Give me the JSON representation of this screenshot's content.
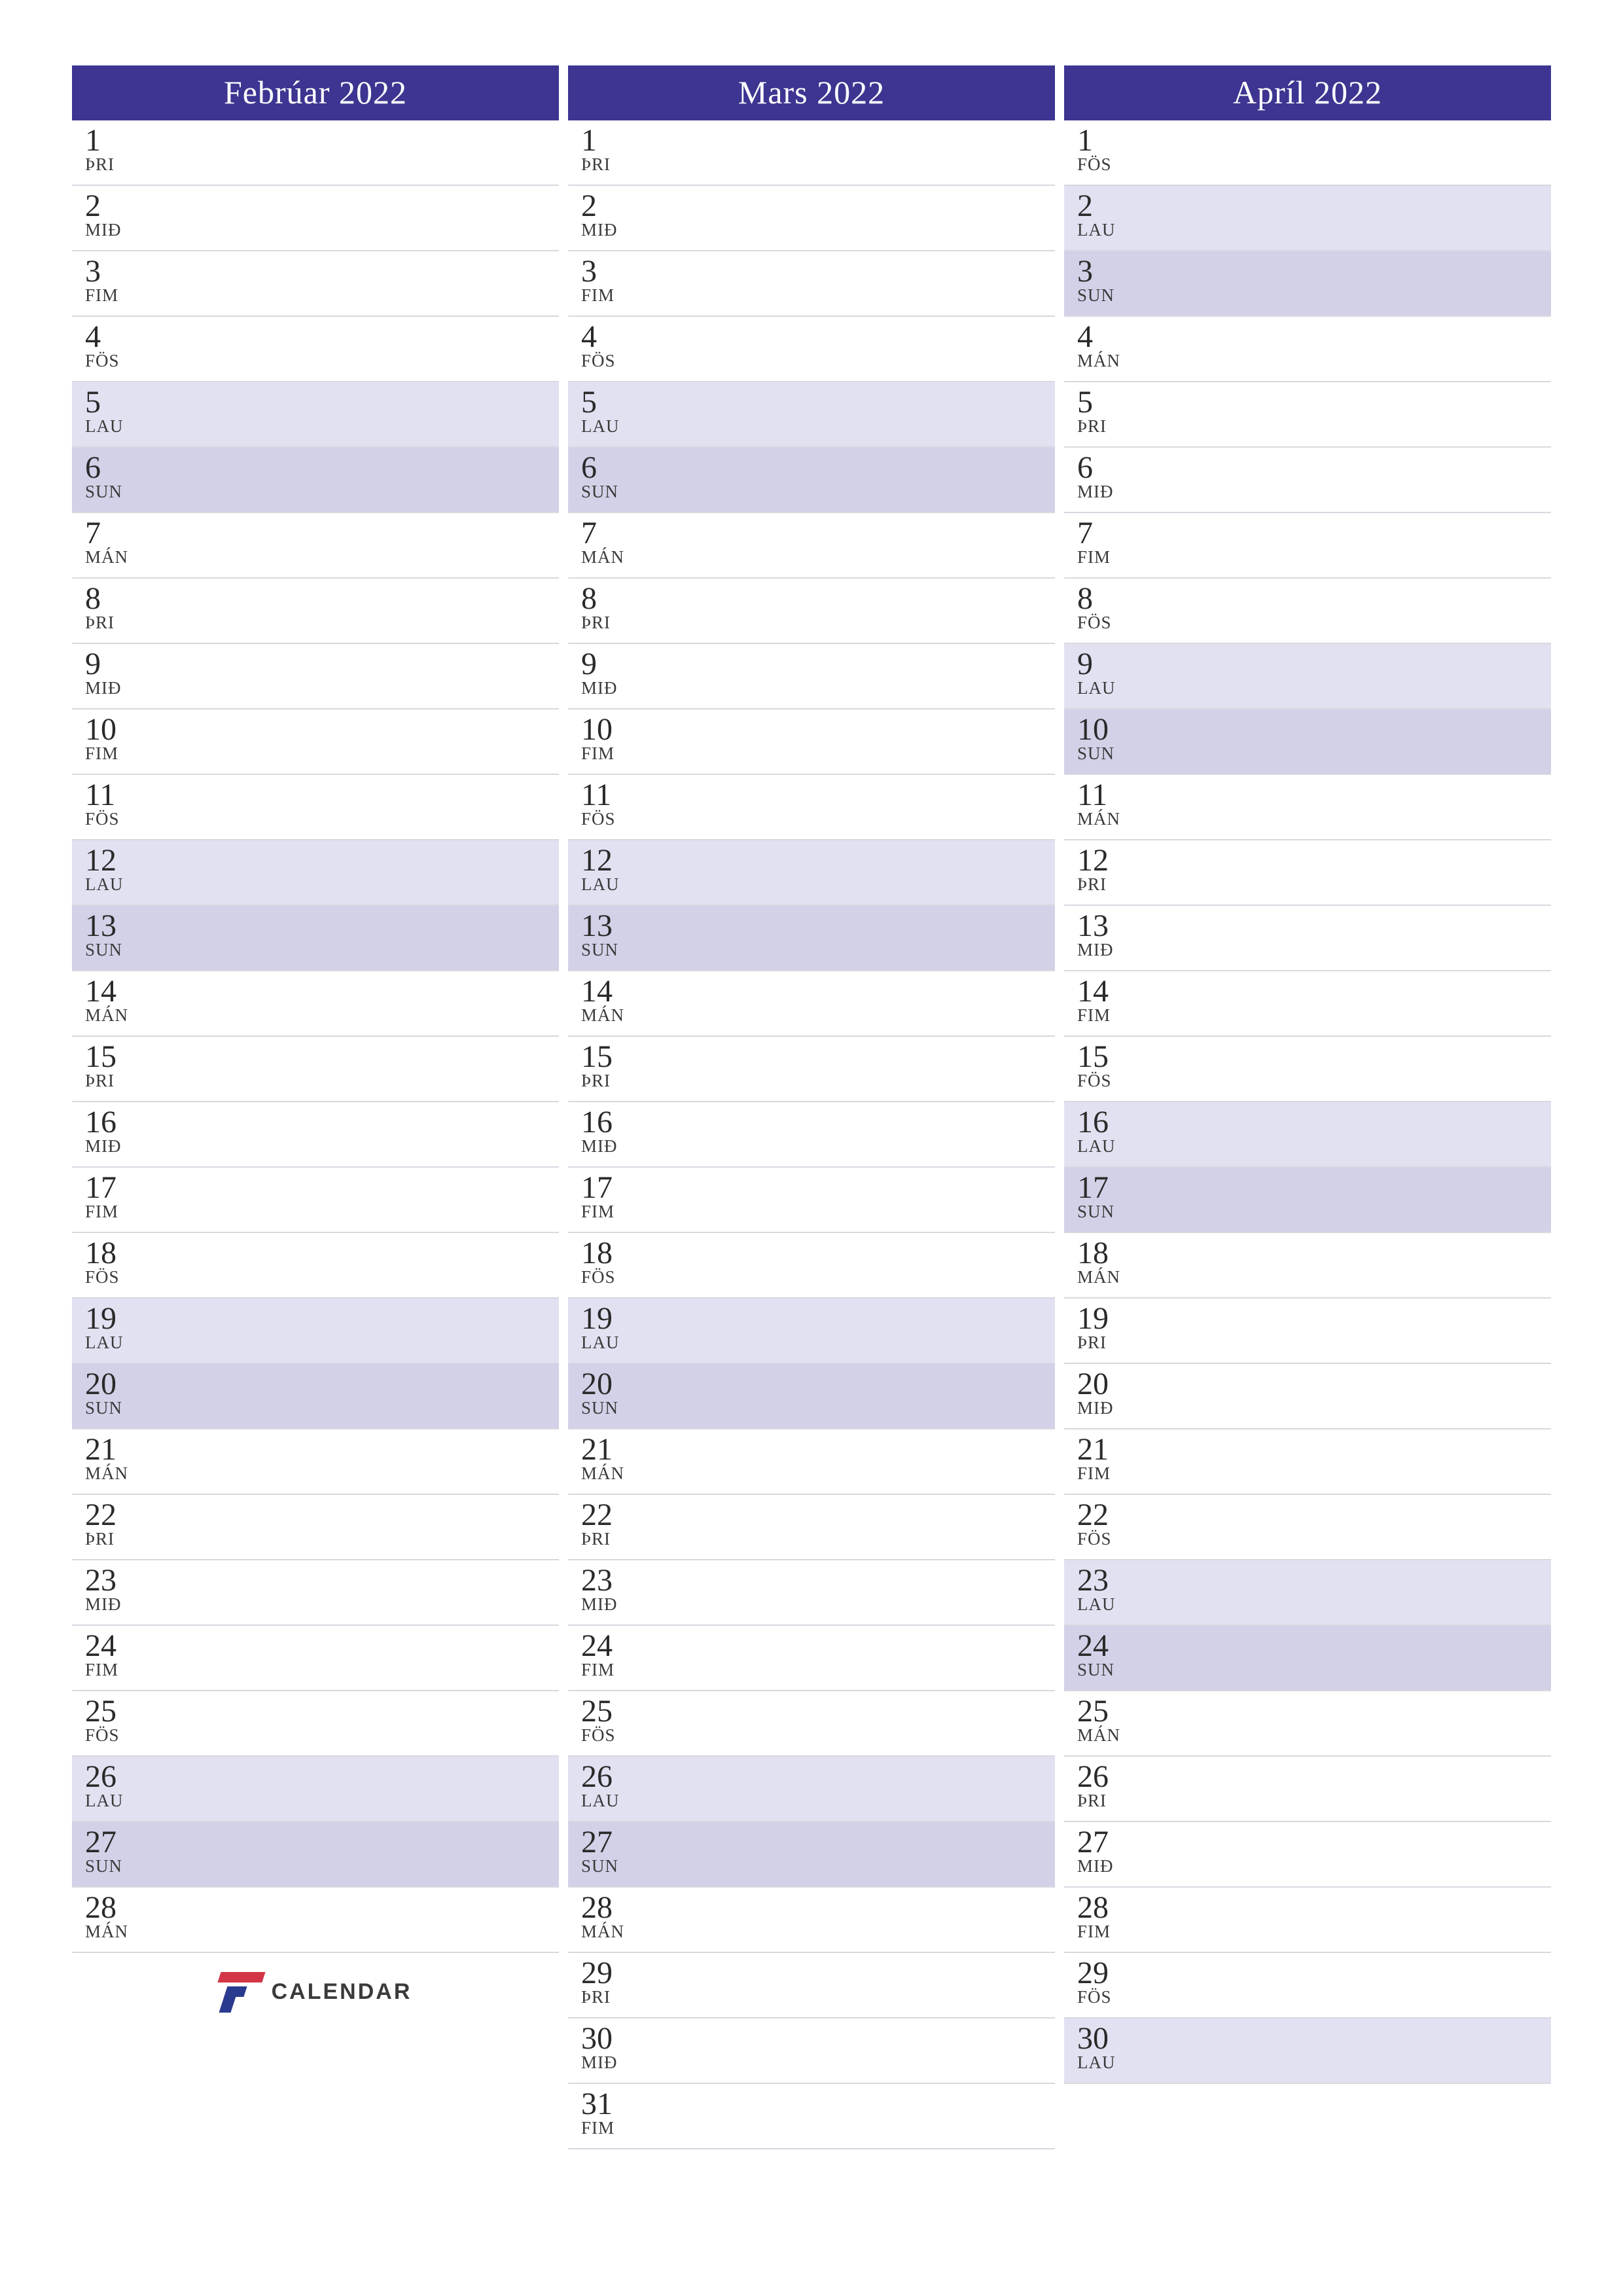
{
  "brand": {
    "name": "CALENDAR"
  },
  "weekday_labels": {
    "mon": "MÁN",
    "tue": "ÞRI",
    "wed": "MIÐ",
    "thu": "FIM",
    "fri": "FÖS",
    "sat": "LAU",
    "sun": "SUN"
  },
  "months": [
    {
      "title": "Febrúar 2022",
      "logo_after": 28,
      "days": [
        {
          "n": "1",
          "w": "tue"
        },
        {
          "n": "2",
          "w": "wed"
        },
        {
          "n": "3",
          "w": "thu"
        },
        {
          "n": "4",
          "w": "fri"
        },
        {
          "n": "5",
          "w": "sat"
        },
        {
          "n": "6",
          "w": "sun"
        },
        {
          "n": "7",
          "w": "mon"
        },
        {
          "n": "8",
          "w": "tue"
        },
        {
          "n": "9",
          "w": "wed"
        },
        {
          "n": "10",
          "w": "thu"
        },
        {
          "n": "11",
          "w": "fri"
        },
        {
          "n": "12",
          "w": "sat"
        },
        {
          "n": "13",
          "w": "sun"
        },
        {
          "n": "14",
          "w": "mon"
        },
        {
          "n": "15",
          "w": "tue"
        },
        {
          "n": "16",
          "w": "wed"
        },
        {
          "n": "17",
          "w": "thu"
        },
        {
          "n": "18",
          "w": "fri"
        },
        {
          "n": "19",
          "w": "sat"
        },
        {
          "n": "20",
          "w": "sun"
        },
        {
          "n": "21",
          "w": "mon"
        },
        {
          "n": "22",
          "w": "tue"
        },
        {
          "n": "23",
          "w": "wed"
        },
        {
          "n": "24",
          "w": "thu"
        },
        {
          "n": "25",
          "w": "fri"
        },
        {
          "n": "26",
          "w": "sat"
        },
        {
          "n": "27",
          "w": "sun"
        },
        {
          "n": "28",
          "w": "mon"
        }
      ]
    },
    {
      "title": "Mars 2022",
      "days": [
        {
          "n": "1",
          "w": "tue"
        },
        {
          "n": "2",
          "w": "wed"
        },
        {
          "n": "3",
          "w": "thu"
        },
        {
          "n": "4",
          "w": "fri"
        },
        {
          "n": "5",
          "w": "sat"
        },
        {
          "n": "6",
          "w": "sun"
        },
        {
          "n": "7",
          "w": "mon"
        },
        {
          "n": "8",
          "w": "tue"
        },
        {
          "n": "9",
          "w": "wed"
        },
        {
          "n": "10",
          "w": "thu"
        },
        {
          "n": "11",
          "w": "fri"
        },
        {
          "n": "12",
          "w": "sat"
        },
        {
          "n": "13",
          "w": "sun"
        },
        {
          "n": "14",
          "w": "mon"
        },
        {
          "n": "15",
          "w": "tue"
        },
        {
          "n": "16",
          "w": "wed"
        },
        {
          "n": "17",
          "w": "thu"
        },
        {
          "n": "18",
          "w": "fri"
        },
        {
          "n": "19",
          "w": "sat"
        },
        {
          "n": "20",
          "w": "sun"
        },
        {
          "n": "21",
          "w": "mon"
        },
        {
          "n": "22",
          "w": "tue"
        },
        {
          "n": "23",
          "w": "wed"
        },
        {
          "n": "24",
          "w": "thu"
        },
        {
          "n": "25",
          "w": "fri"
        },
        {
          "n": "26",
          "w": "sat"
        },
        {
          "n": "27",
          "w": "sun"
        },
        {
          "n": "28",
          "w": "mon"
        },
        {
          "n": "29",
          "w": "tue"
        },
        {
          "n": "30",
          "w": "wed"
        },
        {
          "n": "31",
          "w": "thu"
        }
      ]
    },
    {
      "title": "Apríl 2022",
      "days": [
        {
          "n": "1",
          "w": "fri"
        },
        {
          "n": "2",
          "w": "sat"
        },
        {
          "n": "3",
          "w": "sun"
        },
        {
          "n": "4",
          "w": "mon"
        },
        {
          "n": "5",
          "w": "tue"
        },
        {
          "n": "6",
          "w": "wed"
        },
        {
          "n": "7",
          "w": "thu"
        },
        {
          "n": "8",
          "w": "fri"
        },
        {
          "n": "9",
          "w": "sat"
        },
        {
          "n": "10",
          "w": "sun"
        },
        {
          "n": "11",
          "w": "mon"
        },
        {
          "n": "12",
          "w": "tue"
        },
        {
          "n": "13",
          "w": "wed"
        },
        {
          "n": "14",
          "w": "thu"
        },
        {
          "n": "15",
          "w": "fri"
        },
        {
          "n": "16",
          "w": "sat"
        },
        {
          "n": "17",
          "w": "sun"
        },
        {
          "n": "18",
          "w": "mon"
        },
        {
          "n": "19",
          "w": "tue"
        },
        {
          "n": "20",
          "w": "wed"
        },
        {
          "n": "21",
          "w": "thu"
        },
        {
          "n": "22",
          "w": "fri"
        },
        {
          "n": "23",
          "w": "sat"
        },
        {
          "n": "24",
          "w": "sun"
        },
        {
          "n": "25",
          "w": "mon"
        },
        {
          "n": "26",
          "w": "tue"
        },
        {
          "n": "27",
          "w": "wed"
        },
        {
          "n": "28",
          "w": "thu"
        },
        {
          "n": "29",
          "w": "fri"
        },
        {
          "n": "30",
          "w": "sat"
        }
      ]
    }
  ]
}
